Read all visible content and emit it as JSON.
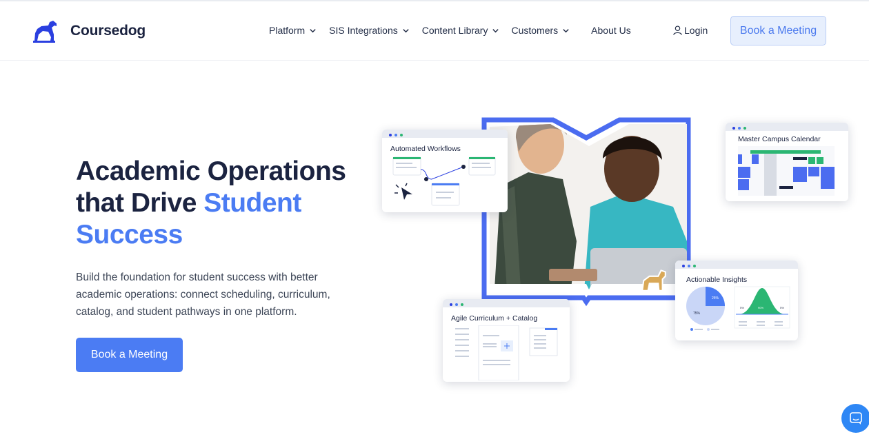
{
  "header": {
    "brand": "Coursedog",
    "nav": [
      {
        "label": "Platform"
      },
      {
        "label": "SIS Integrations"
      },
      {
        "label": "Content Library"
      },
      {
        "label": "Customers"
      },
      {
        "label": "About Us"
      }
    ],
    "login_label": "Login",
    "cta_label": "Book a Meeting"
  },
  "hero": {
    "title_line1": "Academic Operations",
    "title_line2_plain": "that Drive ",
    "title_line2_accent": "Student",
    "title_line3_accent": "Success",
    "subtitle": "Build the foundation for student success with better academic operations: connect scheduling, curriculum, catalog, and student pathways in one platform.",
    "cta_label": "Book a Meeting"
  },
  "illustration": {
    "cards": {
      "workflows": "Automated Workflows",
      "calendar": "Master Campus Calendar",
      "insights": "Actionable Insights",
      "curriculum": "Agile Curriculum + Catalog"
    },
    "pie_labels": [
      "25%",
      "75%"
    ],
    "curve_labels": [
      "5%",
      "90%",
      "5%"
    ]
  },
  "colors": {
    "accent": "#4b7cf3",
    "brand_navy": "#1b2340",
    "green": "#2bb673",
    "frame": "#4b6cf0"
  },
  "icons": [
    "dog-logo-icon",
    "chevron-down-icon",
    "user-icon",
    "chat-icon"
  ]
}
